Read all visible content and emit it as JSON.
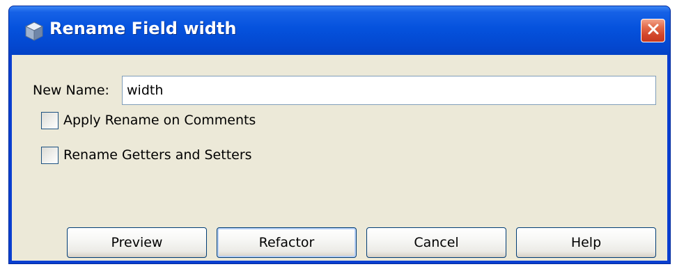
{
  "dialog": {
    "title": "Rename Field width",
    "app_icon": "netbeans-cube-icon",
    "close_icon": "close-x-icon"
  },
  "form": {
    "new_name_label": "New Name:",
    "new_name_value": "width"
  },
  "options": [
    {
      "label": "Apply Rename on Comments",
      "checked": false
    },
    {
      "label": "Rename Getters and Setters",
      "checked": false
    }
  ],
  "buttons": {
    "preview": "Preview",
    "refactor": "Refactor",
    "cancel": "Cancel",
    "help": "Help"
  },
  "colors": {
    "titlebar": "#0552dd",
    "dialog_bg": "#ece9d8",
    "close_button": "#d2452a"
  }
}
